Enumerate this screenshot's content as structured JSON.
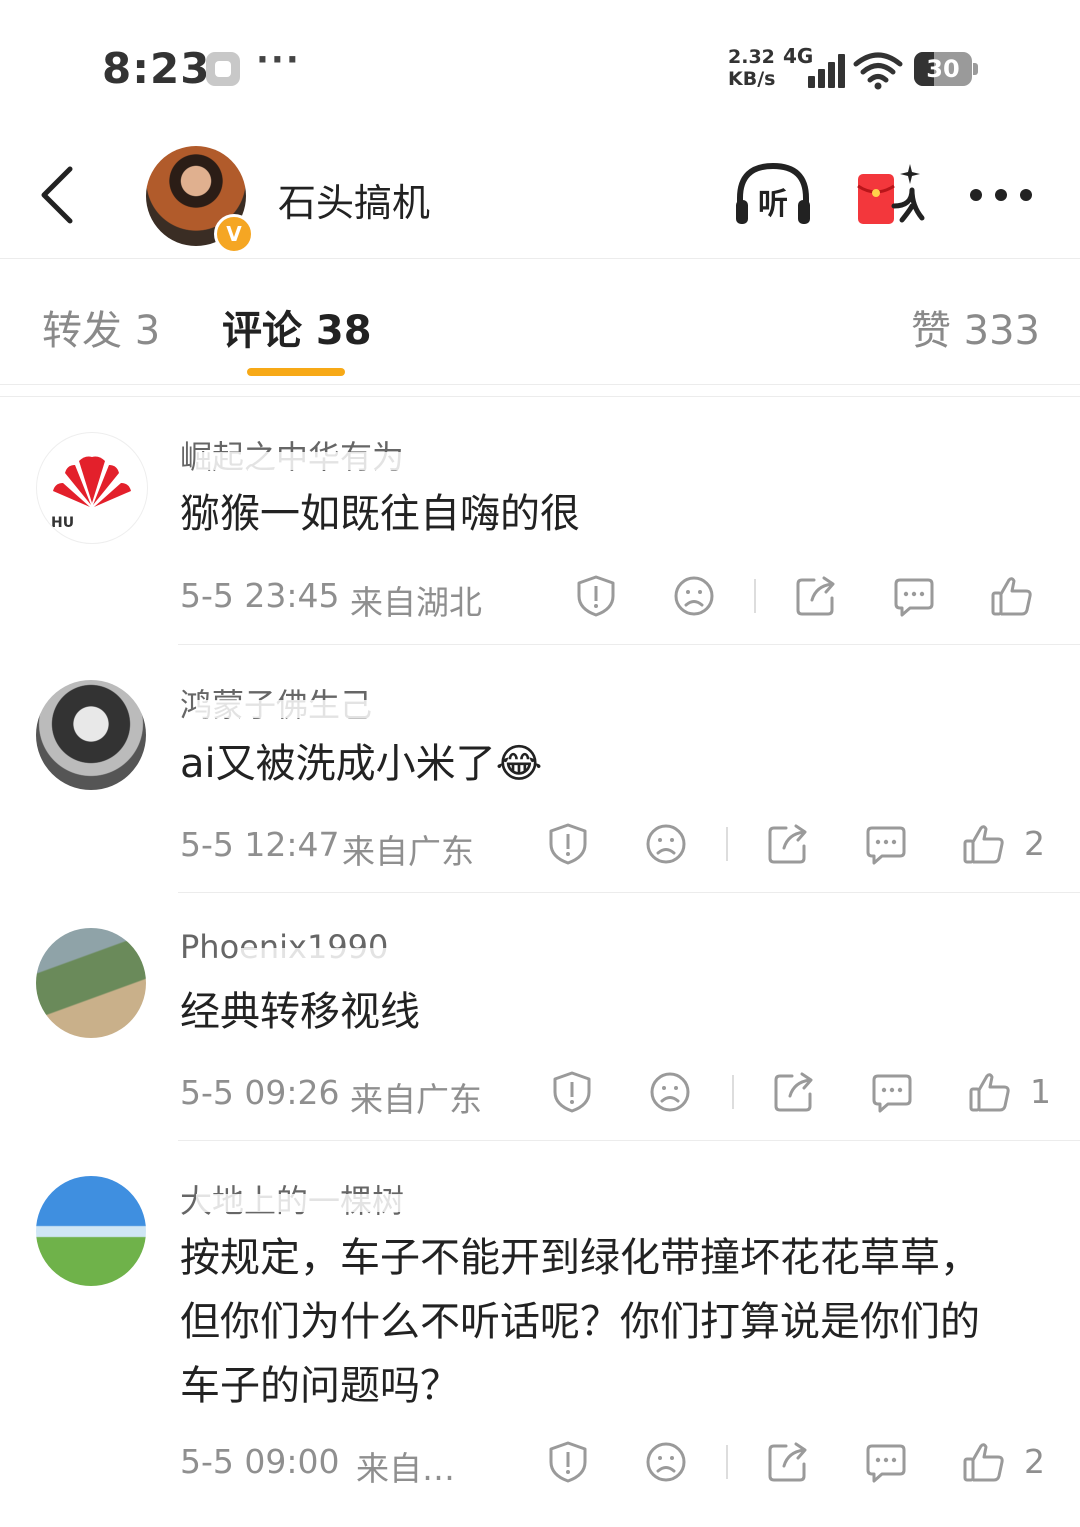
{
  "status_bar": {
    "time": "8:23",
    "dots": "···",
    "net_speed_value": "2.32",
    "net_speed_unit": "KB/s",
    "network": "4G",
    "battery": "30"
  },
  "header": {
    "user_name": "石头搞机",
    "verified_mark": "V",
    "icons": [
      "back-icon",
      "listen-icon",
      "red-packet-icon",
      "more-icon"
    ]
  },
  "tabs": {
    "repost": "转发 3",
    "comments": "评论 38",
    "likes": "赞 333",
    "active": "comments",
    "accent_color": "#f7a917"
  },
  "comments": [
    {
      "username": "崛起之中华有为",
      "text": "猕猴一如既往自嗨的很",
      "time": "5-5 23:45",
      "location": "来自湖北",
      "likes": ""
    },
    {
      "username": "鸿蒙子佛生己",
      "text": "ai又被洗成小米了",
      "emoji": "😂",
      "time": "5-5 12:47",
      "location": "来自广东",
      "likes": "2"
    },
    {
      "username": "Phoenix1990",
      "text": "经典转移视线",
      "time": "5-5 09:26",
      "location": "来自广东",
      "likes": "1"
    },
    {
      "username": "大地上的一棵树",
      "text_lines": [
        "按规定，车子不能开到绿化带撞坏花花草草，",
        "但你们为什么不听话呢？你们打算说是你们的",
        "车子的问题吗？"
      ],
      "time": "5-5 09:00",
      "location": "来自…",
      "likes": "2"
    }
  ]
}
